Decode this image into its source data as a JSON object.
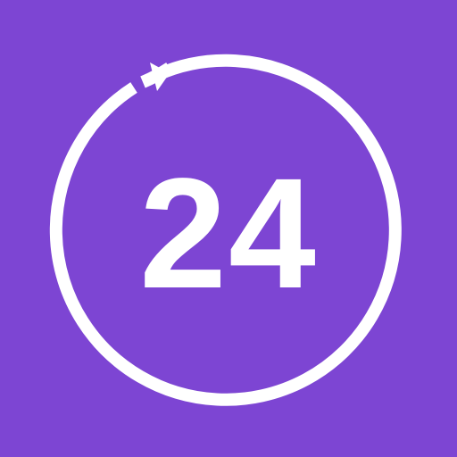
{
  "app_icon": {
    "label": "24",
    "background_color": "#7d45d3",
    "foreground_color": "#ffffff",
    "ring_icon": "circular-arrow-icon"
  }
}
